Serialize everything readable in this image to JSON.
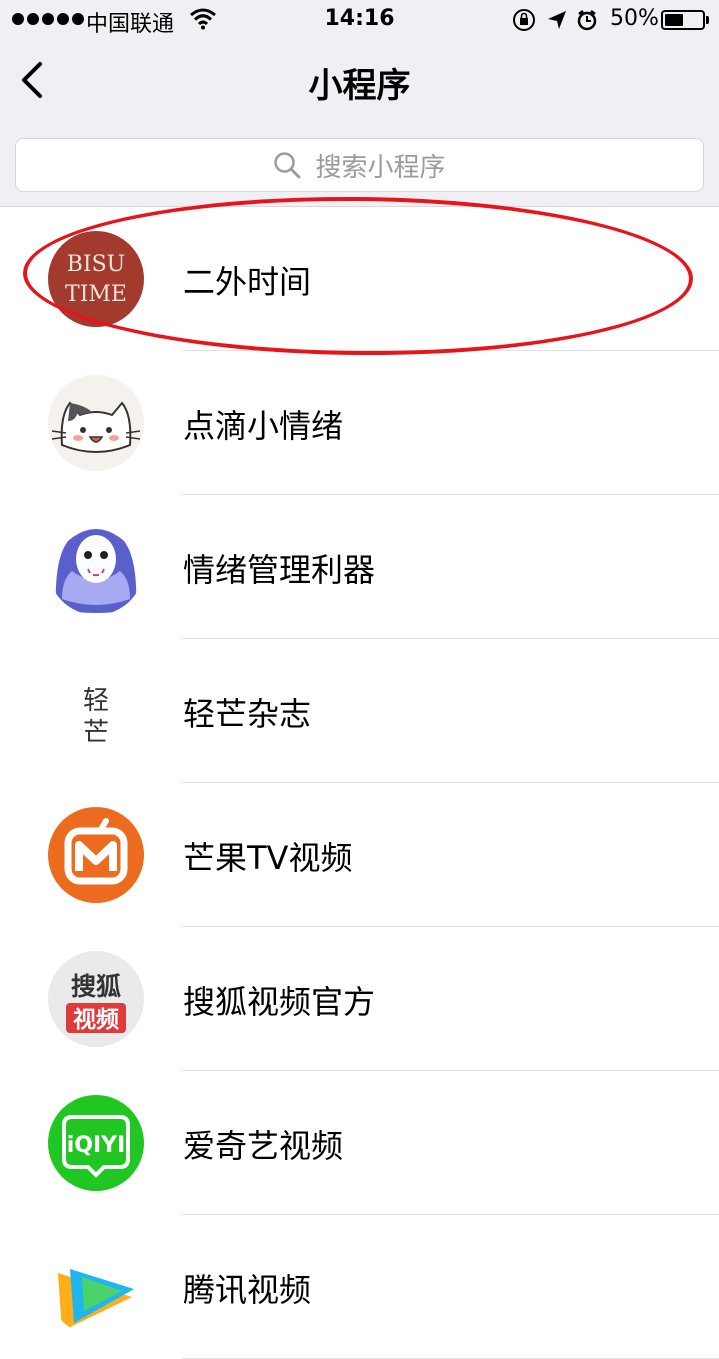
{
  "status_bar": {
    "carrier": "中国联通",
    "time": "14:16",
    "battery_percent": "50%",
    "battery_level": 0.5,
    "icons": [
      "signal-dots-icon",
      "wifi-icon",
      "rotation-lock-icon",
      "location-arrow-icon",
      "alarm-icon",
      "battery-icon"
    ]
  },
  "nav": {
    "title": "小程序",
    "back_icon": "chevron-left-icon"
  },
  "search": {
    "placeholder": "搜索小程序",
    "icon": "search-icon"
  },
  "list": {
    "items": [
      {
        "name": "二外时间",
        "icon": "bisu-time-logo",
        "logo_text": [
          "BISU",
          "TIME"
        ]
      },
      {
        "name": "点滴小情绪",
        "icon": "cat-face-icon"
      },
      {
        "name": "情绪管理利器",
        "icon": "masked-ghost-icon"
      },
      {
        "name": "轻芒杂志",
        "icon": "qingmang-logo",
        "logo_text": [
          "轻",
          "芒"
        ]
      },
      {
        "name": "芒果TV视频",
        "icon": "mango-tv-logo"
      },
      {
        "name": "搜狐视频官方",
        "icon": "sohu-video-logo",
        "logo_text": [
          "搜狐",
          "视频"
        ]
      },
      {
        "name": "爱奇艺视频",
        "icon": "iqiyi-logo",
        "logo_text": [
          "iQIYI"
        ]
      },
      {
        "name": "腾讯视频",
        "icon": "tencent-video-logo"
      }
    ]
  },
  "annotation": {
    "highlight_color": "#e8141b"
  },
  "colors": {
    "header_bg": "#efeff4",
    "placeholder": "#9b9b9b",
    "bisu": "#a33a2e",
    "mango": "#ec6b1f",
    "iqiyi": "#20c722",
    "sohu_red": "#e03b3b"
  }
}
